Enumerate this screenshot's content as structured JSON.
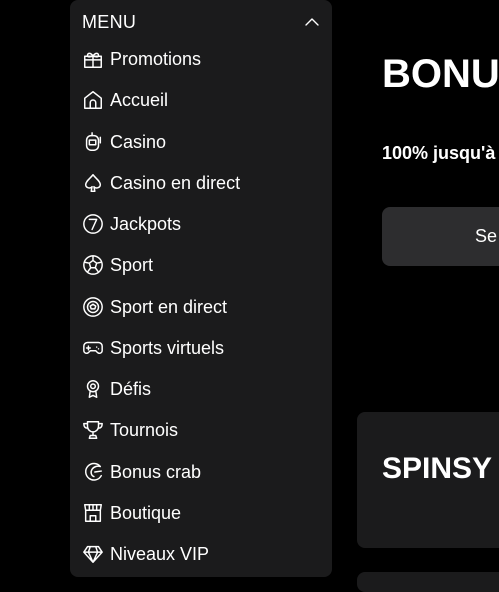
{
  "menu": {
    "title": "MENU",
    "items": [
      {
        "label": "Promotions",
        "icon": "gift-icon"
      },
      {
        "label": "Accueil",
        "icon": "home-icon"
      },
      {
        "label": "Casino",
        "icon": "slot-machine-icon"
      },
      {
        "label": "Casino en direct",
        "icon": "spade-icon"
      },
      {
        "label": "Jackpots",
        "icon": "seven-icon"
      },
      {
        "label": "Sport",
        "icon": "soccer-ball-icon"
      },
      {
        "label": "Sport en direct",
        "icon": "live-ball-icon"
      },
      {
        "label": "Sports virtuels",
        "icon": "gamepad-icon"
      },
      {
        "label": "Défis",
        "icon": "medal-icon"
      },
      {
        "label": "Tournois",
        "icon": "trophy-icon"
      },
      {
        "label": "Bonus crab",
        "icon": "claw-icon"
      },
      {
        "label": "Boutique",
        "icon": "shop-icon"
      },
      {
        "label": "Niveaux VIP",
        "icon": "diamond-icon"
      }
    ]
  },
  "hero": {
    "title": "BONU",
    "subtitle": "100% jusqu'à",
    "button_label": "Se"
  },
  "card": {
    "title": "SPINSY"
  }
}
